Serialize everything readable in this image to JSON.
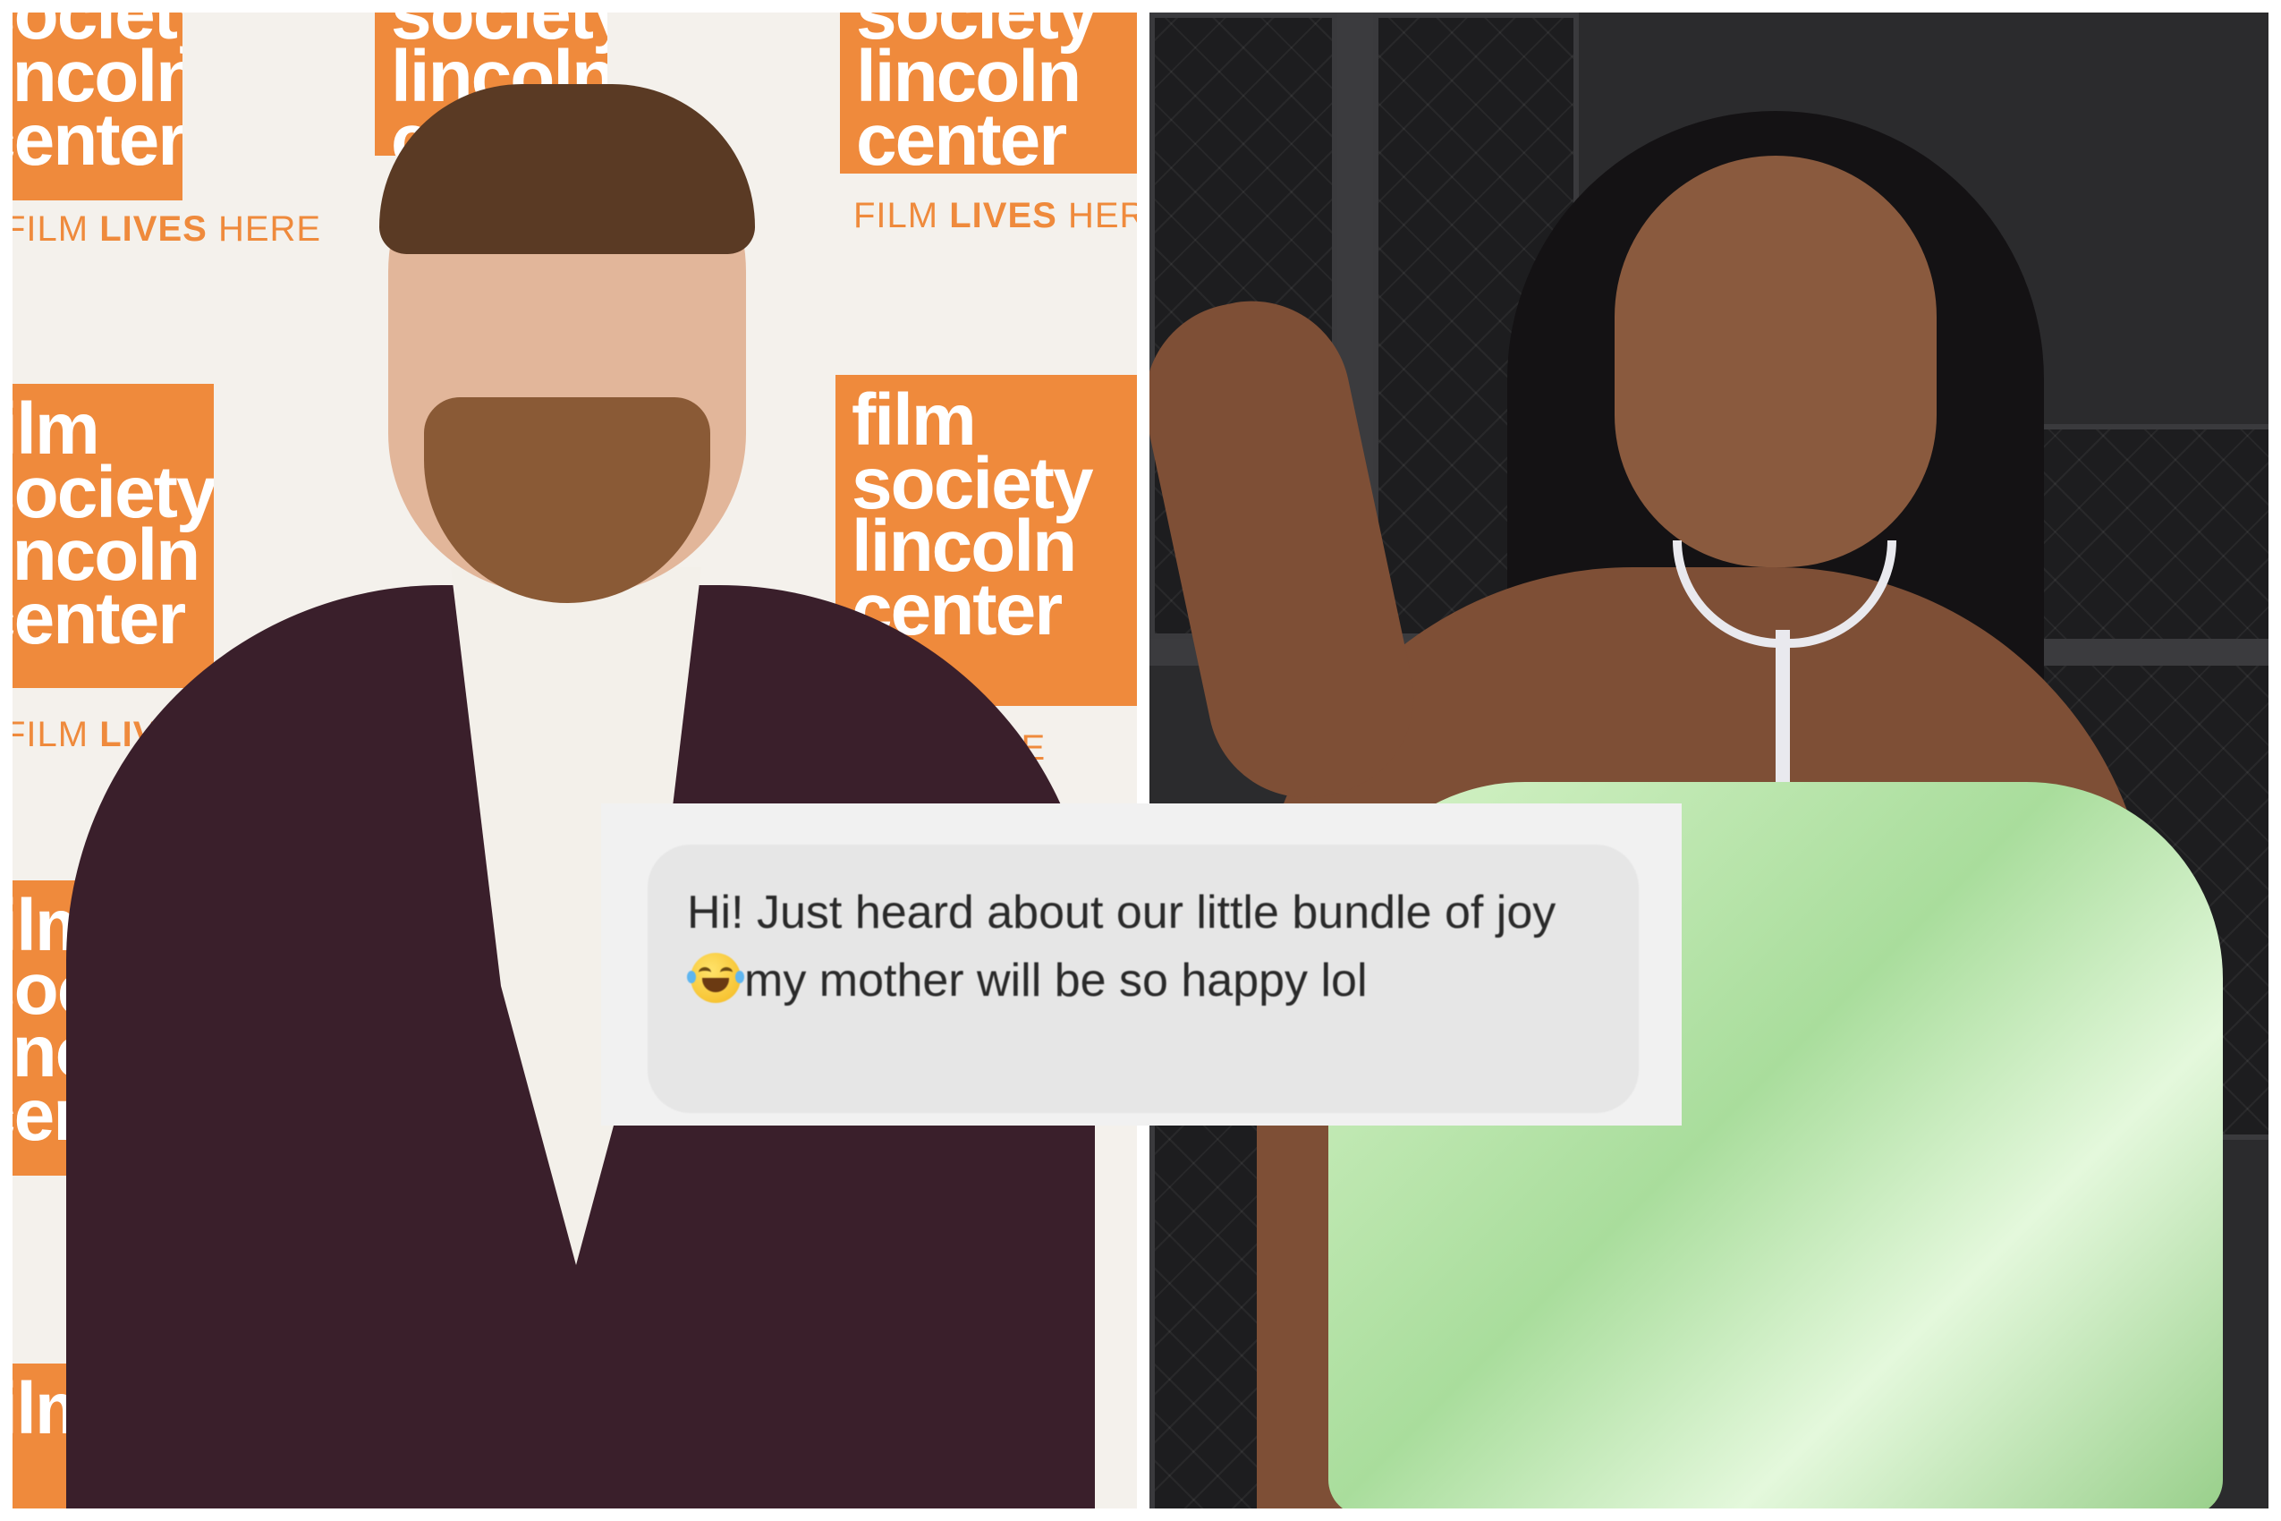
{
  "left_photo": {
    "backdrop_logo_lines": [
      "film",
      "society",
      "lincoln",
      "center"
    ],
    "tagline_regular_1": "FILM ",
    "tagline_bold": "LIVES",
    "tagline_regular_2": " HERE",
    "backdrop_color": "#ef8a3c"
  },
  "right_photo": {
    "backdrop_color": "#2b2b2d",
    "dress_color": "#b8e6a8"
  },
  "message": {
    "text_before_emoji": "Hi! Just heard about our little bundle of joy ",
    "emoji": "face-with-tears-of-joy-icon",
    "text_after_emoji": "my mother will be so happy lol"
  }
}
